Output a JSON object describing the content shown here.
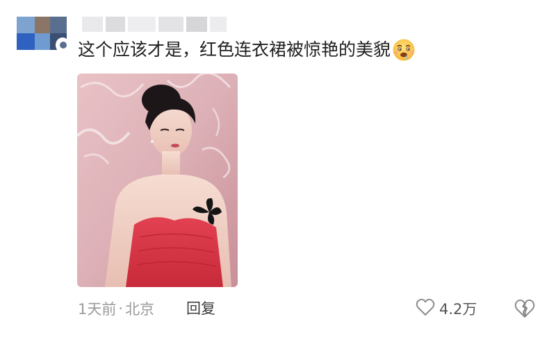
{
  "comment": {
    "text": "这个应该才是，红色连衣裙被惊艳的美貌",
    "emoji_icon": "drooling-face-emoji"
  },
  "meta": {
    "time": "1天前",
    "separator": "·",
    "location": "北京"
  },
  "actions": {
    "reply_label": "回复",
    "like_count": "4.2万"
  },
  "colors": {
    "text_primary": "#1f1f1f",
    "text_secondary": "#9a9a9a",
    "dress_red": "#d8323f",
    "background": "#ffffff"
  }
}
